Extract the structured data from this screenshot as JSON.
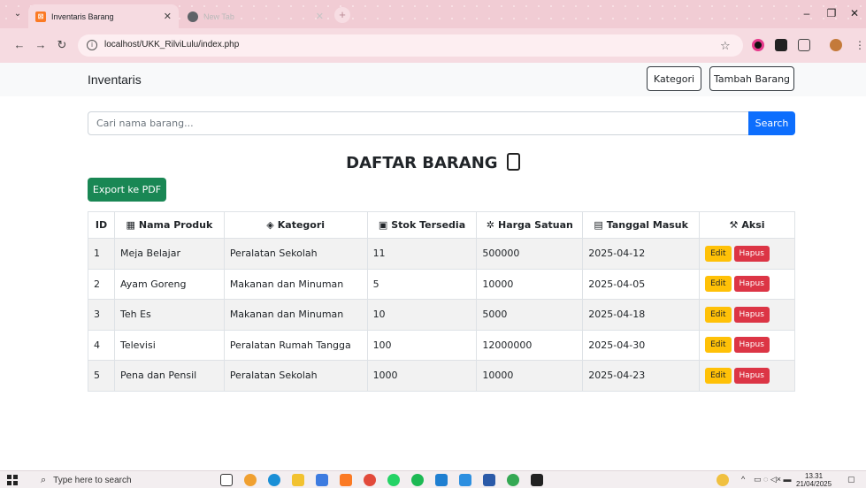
{
  "browser": {
    "tabs": [
      {
        "title": "Inventaris Barang",
        "active": true
      },
      {
        "title": "New Tab",
        "active": false
      }
    ],
    "url": "localhost/UKK_RilviLulu/index.php"
  },
  "app": {
    "brand": "Inventaris",
    "nav_buttons": {
      "kategori": "Kategori",
      "tambah": "Tambah Barang"
    },
    "search": {
      "placeholder": "Cari nama barang...",
      "button": "Search"
    },
    "heading": "DAFTAR BARANG",
    "export_button": "Export ke PDF",
    "table": {
      "headers": {
        "id": "ID",
        "nama": "Nama Produk",
        "kategori": "Kategori",
        "stok": "Stok Tersedia",
        "harga": "Harga Satuan",
        "tanggal": "Tanggal Masuk",
        "aksi": "Aksi"
      },
      "header_icons": {
        "nama": "box-icon",
        "kategori": "tag-icon",
        "stok": "package-icon",
        "harga": "price-icon",
        "tanggal": "calendar-icon",
        "aksi": "tools-icon"
      },
      "rows": [
        {
          "id": "1",
          "nama": "Meja Belajar",
          "kategori": "Peralatan Sekolah",
          "stok": "11",
          "harga": "500000",
          "tanggal": "2025-04-12"
        },
        {
          "id": "2",
          "nama": "Ayam Goreng",
          "kategori": "Makanan dan Minuman",
          "stok": "5",
          "harga": "10000",
          "tanggal": "2025-04-05"
        },
        {
          "id": "3",
          "nama": "Teh Es",
          "kategori": "Makanan dan Minuman",
          "stok": "10",
          "harga": "5000",
          "tanggal": "2025-04-18"
        },
        {
          "id": "4",
          "nama": "Televisi",
          "kategori": "Peralatan Rumah Tangga",
          "stok": "100",
          "harga": "12000000",
          "tanggal": "2025-04-30"
        },
        {
          "id": "5",
          "nama": "Pena dan Pensil",
          "kategori": "Peralatan Sekolah",
          "stok": "1000",
          "harga": "10000",
          "tanggal": "2025-04-23"
        }
      ],
      "edit_label": "Edit",
      "hapus_label": "Hapus"
    }
  },
  "taskbar": {
    "search_placeholder": "Type here to search",
    "time": "13.31",
    "date": "21/04/2025"
  },
  "colors": {
    "primary": "#0d6efd",
    "success": "#198754",
    "warning": "#ffc107",
    "danger": "#dc3545",
    "tab_strip": "#f1ccd4"
  }
}
